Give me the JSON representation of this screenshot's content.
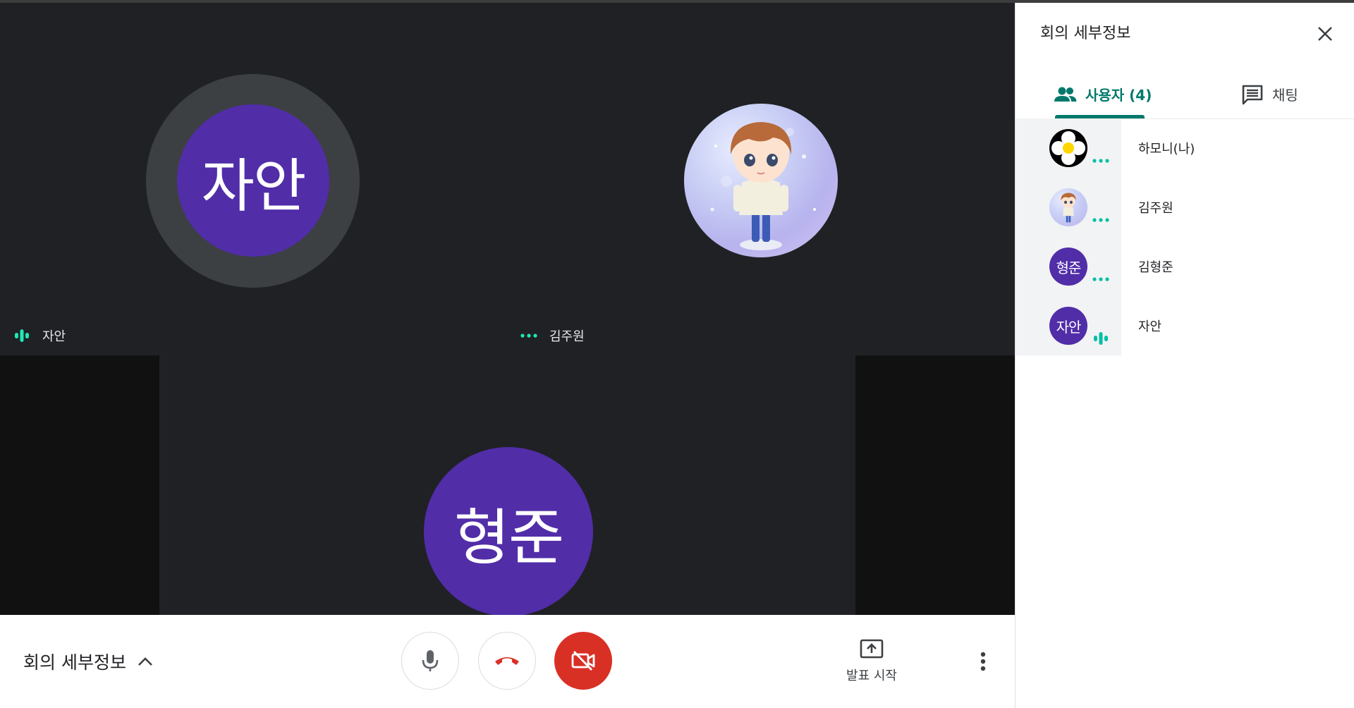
{
  "stage": {
    "tiles": [
      {
        "name": "자안",
        "avatar_text": "자안",
        "status": "speaking"
      },
      {
        "name": "김주원",
        "status": "idle"
      },
      {
        "avatar_text": "형준"
      }
    ]
  },
  "bottom_bar": {
    "meeting_details_label": "회의 세부정보",
    "present_label": "발표 시작",
    "camera_state": "off",
    "colors": {
      "hangup": "#d93025",
      "camera_off_bg": "#d93025"
    }
  },
  "panel": {
    "title": "회의 세부정보",
    "tabs": [
      {
        "label": "사용자 (4)",
        "icon": "people-icon",
        "active": true
      },
      {
        "label": "채팅",
        "icon": "chat-icon",
        "active": false
      }
    ],
    "people": [
      {
        "name": "하모니(나)",
        "avatar": "flower-photo",
        "status": "idle"
      },
      {
        "name": "김주원",
        "avatar": "character-photo",
        "status": "idle"
      },
      {
        "name": "김형준",
        "avatar_text": "형준",
        "status": "idle"
      },
      {
        "name": "자안",
        "avatar_text": "자안",
        "status": "speaking"
      }
    ]
  },
  "colors": {
    "accent": "#00796b",
    "avatar_bg": "#512da8",
    "indicator": "#1de9b6",
    "stage_bg": "#202124"
  }
}
